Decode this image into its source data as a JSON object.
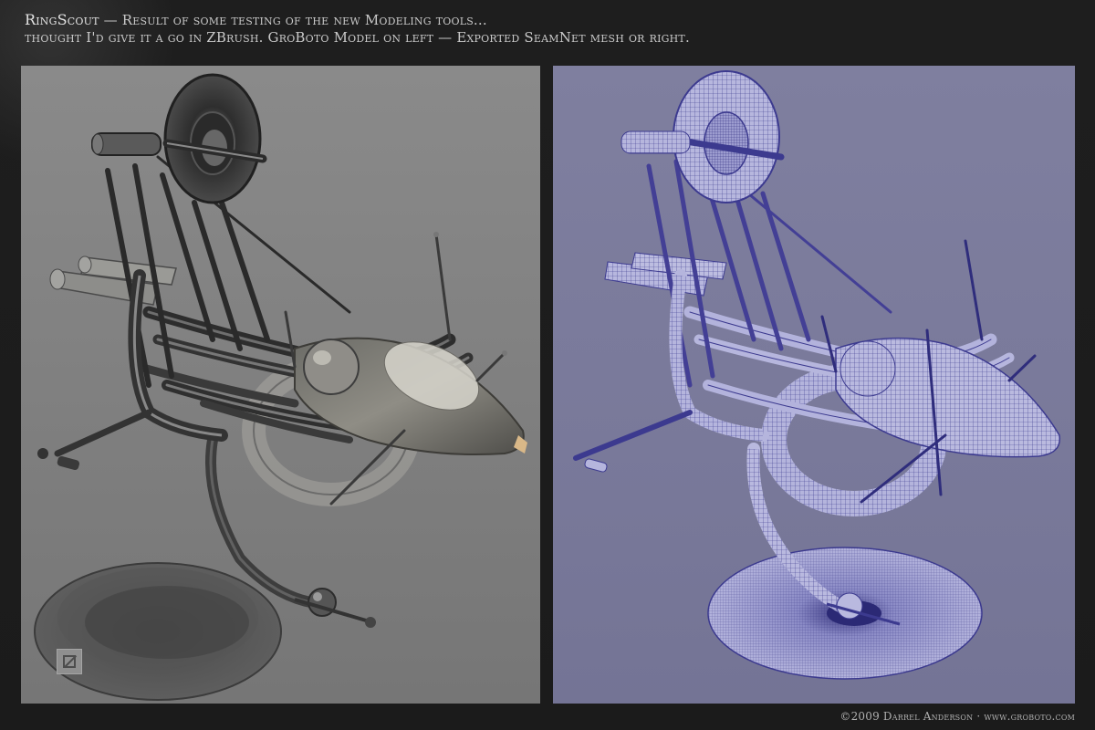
{
  "caption": {
    "title": "RingScout",
    "line1_rest": " — Result of some testing of the new Modeling tools...",
    "line2": "thought I'd give it a go in ZBrush. GroBoto Model on left — Exported SeamNet mesh or right."
  },
  "panels": {
    "left": {
      "description_icon": "groboto-logo-icon",
      "background": "#828282"
    },
    "right": {
      "background": "#7b7b9c",
      "mesh_color": "#3c3a8f"
    }
  },
  "footer": {
    "copyright": "©2009 Darrel Anderson · www.groboto.com"
  }
}
